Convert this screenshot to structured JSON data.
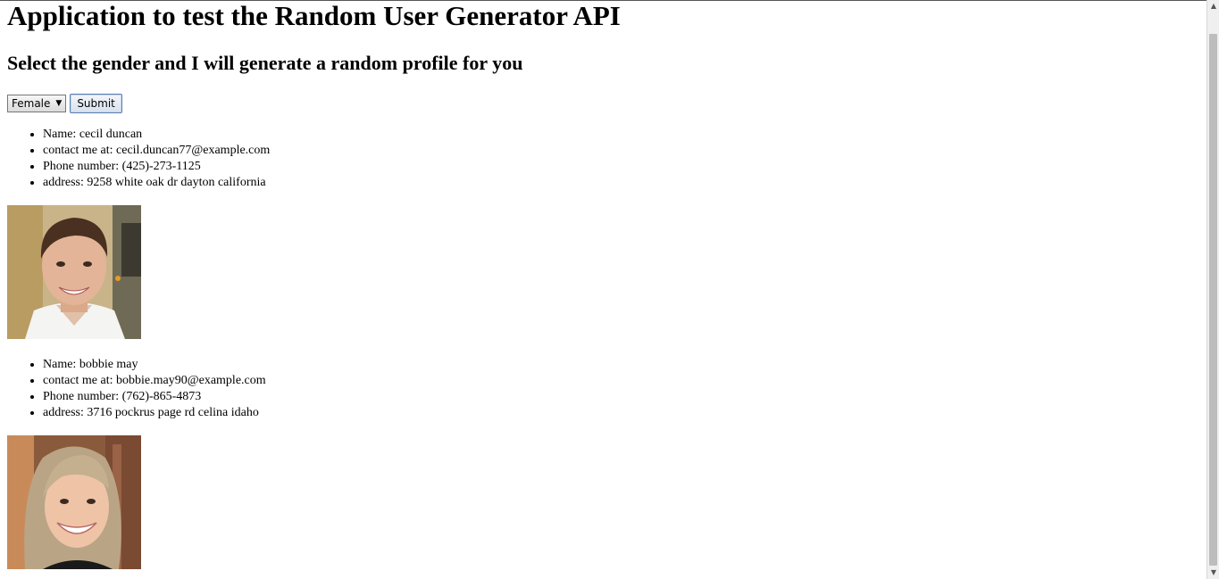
{
  "page": {
    "title": "Application to test the Random User Generator API",
    "subtitle": "Select the gender and I will generate a random profile for you"
  },
  "form": {
    "gender_selected": "Female",
    "submit_label": "Submit"
  },
  "profiles": [
    {
      "name": "Name: cecil duncan",
      "email": "contact me at: cecil.duncan77@example.com",
      "phone": "Phone number: (425)-273-1125",
      "address": "address: 9258 white oak dr dayton california",
      "photo": "man-portrait"
    },
    {
      "name": "Name: bobbie may",
      "email": "contact me at: bobbie.may90@example.com",
      "phone": "Phone number: (762)-865-4873",
      "address": "address: 3716 pockrus page rd celina idaho",
      "photo": "woman-portrait"
    }
  ]
}
